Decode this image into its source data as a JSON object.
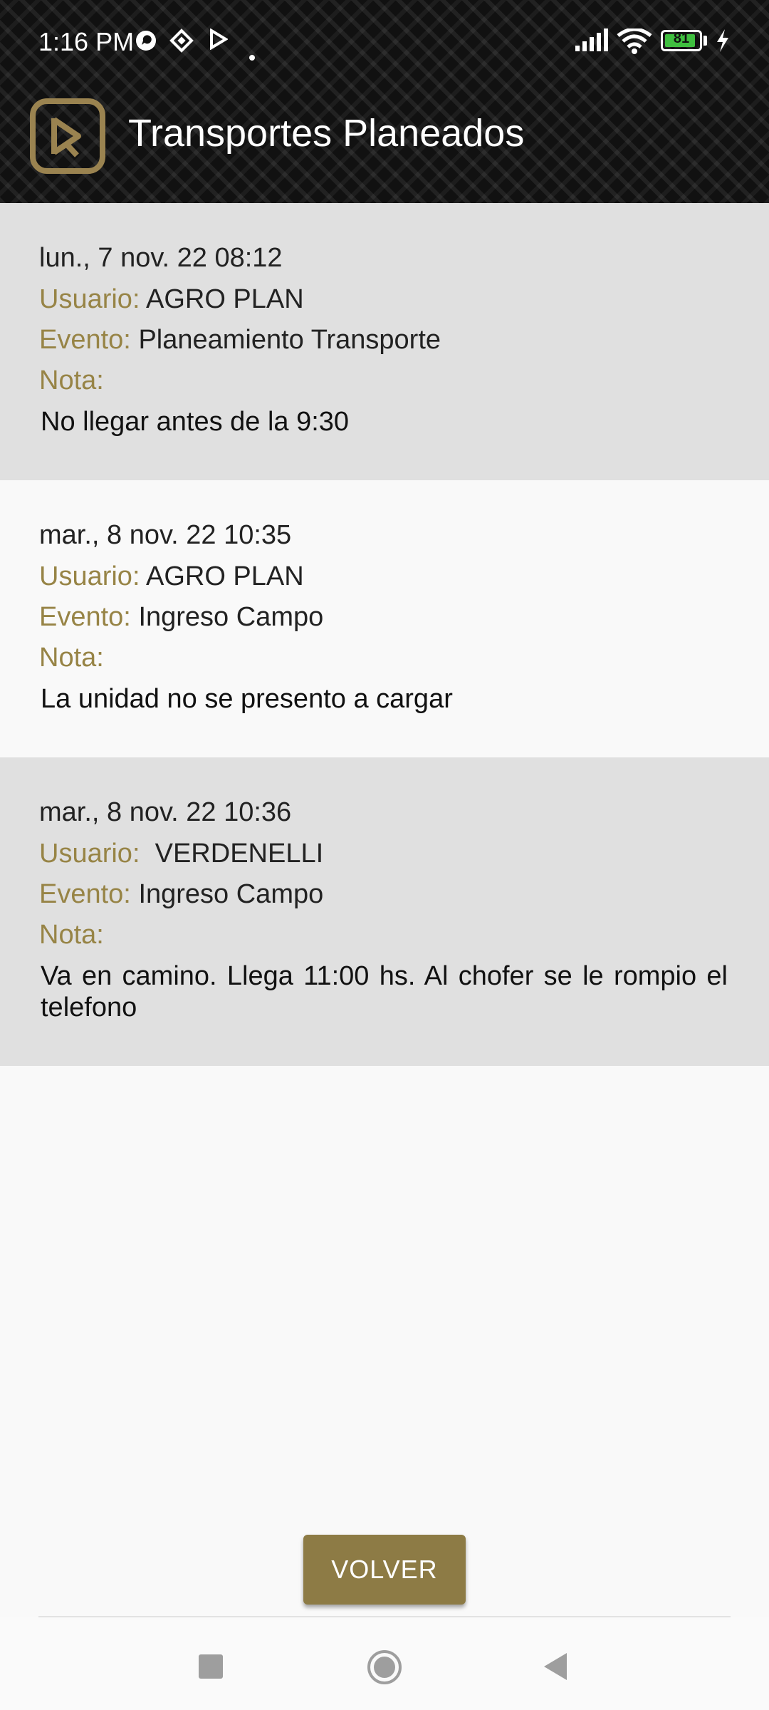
{
  "status_bar": {
    "time": "1:16 PM",
    "battery_percent": "81",
    "icons": [
      "whatsapp-icon",
      "binance-icon",
      "play-store-icon",
      "dot-icon",
      "signal-icon",
      "wifi-icon",
      "battery-icon",
      "charging-icon"
    ]
  },
  "app_bar": {
    "title": "Transportes Planeados",
    "logo_icon": "app-logo-icon"
  },
  "labels": {
    "usuario": "Usuario:",
    "evento": "Evento:",
    "nota": "Nota:"
  },
  "entries": [
    {
      "datetime": "lun., 7 nov. 22 08:12",
      "usuario": "AGRO PLAN",
      "evento": "Planeamiento Transporte",
      "nota": "No llegar antes de la 9:30"
    },
    {
      "datetime": "mar., 8 nov. 22 10:35",
      "usuario": "AGRO PLAN",
      "evento": "Ingreso Campo",
      "nota": "La unidad no se presento a cargar"
    },
    {
      "datetime": "mar., 8 nov. 22 10:36",
      "usuario": " VERDENELLI",
      "evento": "Ingreso Campo",
      "nota": "Va en camino. Llega 11:00 hs. Al chofer se le rompio el telefono"
    }
  ],
  "actions": {
    "volver": "VOLVER"
  },
  "colors": {
    "accent": "#978446",
    "button": "#8d7b45",
    "shaded_row": "#e0e0e0",
    "background": "#f9f9f9"
  }
}
